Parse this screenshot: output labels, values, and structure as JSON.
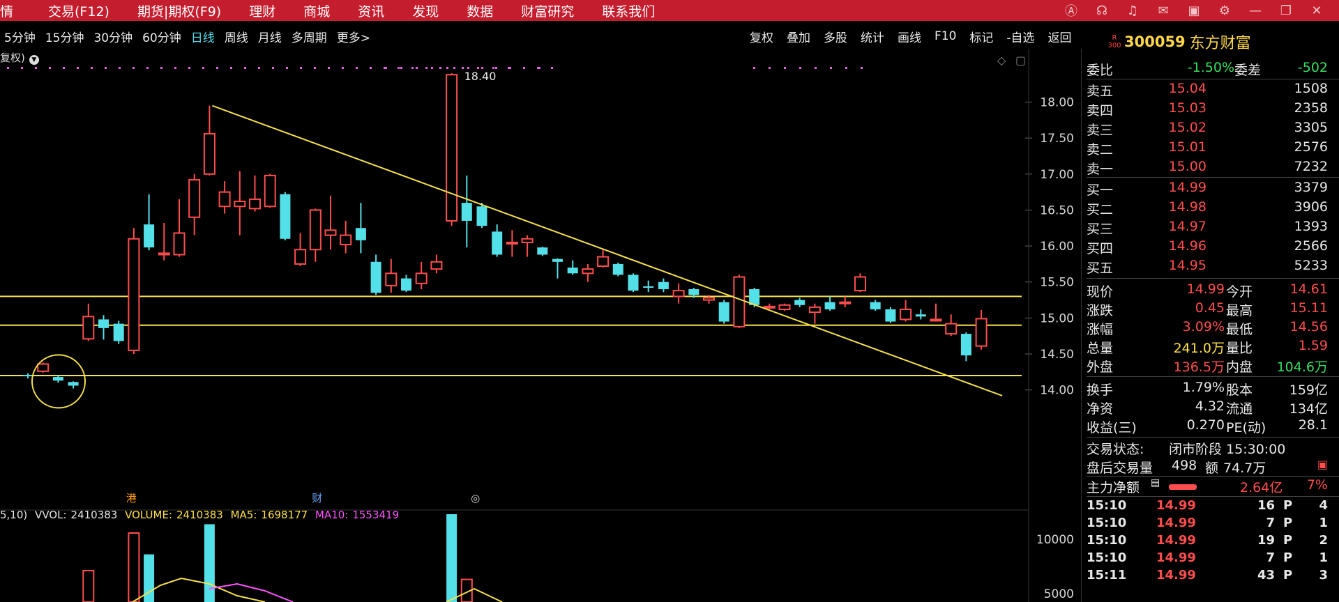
{
  "menu": [
    "情",
    "交易(F12)",
    "期货|期权(F9)",
    "理财",
    "商城",
    "资讯",
    "发现",
    "数据",
    "财富研究",
    "联系我们"
  ],
  "window_icons": [
    "ai-icon",
    "headset-icon",
    "alert-icon",
    "message-icon",
    "box-icon",
    "gear-icon",
    "minimize-icon",
    "restore-icon",
    "close-icon"
  ],
  "periods": [
    {
      "label": "5分钟",
      "active": false
    },
    {
      "label": "15分钟",
      "active": false
    },
    {
      "label": "30分钟",
      "active": false
    },
    {
      "label": "60分钟",
      "active": false
    },
    {
      "label": "日线",
      "active": true
    },
    {
      "label": "周线",
      "active": false
    },
    {
      "label": "月线",
      "active": false
    },
    {
      "label": "多周期",
      "active": false
    },
    {
      "label": "更多>",
      "active": false
    }
  ],
  "tools": [
    "复权",
    "叠加",
    "多股",
    "统计",
    "画线",
    "F10",
    "标记",
    "-自选",
    "返回"
  ],
  "stock": {
    "badge_top": "R",
    "badge_bottom": "300",
    "code": "300059",
    "name": "东方财富"
  },
  "fq_label": "复权)",
  "chart_data": {
    "type": "candlestick",
    "y_ticks": [
      "18.00",
      "17.50",
      "17.00",
      "16.50",
      "16.00",
      "15.50",
      "15.00",
      "14.50",
      "14.00"
    ],
    "ylim": [
      13.9,
      18.45
    ],
    "high_label": "18.40",
    "candles": [
      {
        "o": 14.21,
        "c": 14.19,
        "h": 14.23,
        "l": 14.16
      },
      {
        "o": 14.26,
        "c": 14.36,
        "h": 14.38,
        "l": 14.24
      },
      {
        "o": 14.18,
        "c": 14.13,
        "h": 14.2,
        "l": 14.1
      },
      {
        "o": 14.11,
        "c": 14.06,
        "h": 14.12,
        "l": 14.02
      },
      {
        "o": 14.71,
        "c": 15.02,
        "h": 15.2,
        "l": 14.68
      },
      {
        "o": 14.98,
        "c": 14.86,
        "h": 15.04,
        "l": 14.7
      },
      {
        "o": 14.92,
        "c": 14.68,
        "h": 14.96,
        "l": 14.64
      },
      {
        "o": 14.55,
        "c": 16.1,
        "h": 16.25,
        "l": 14.5
      },
      {
        "o": 16.3,
        "c": 15.98,
        "h": 16.72,
        "l": 15.94
      },
      {
        "o": 15.88,
        "c": 15.9,
        "h": 16.32,
        "l": 15.8
      },
      {
        "o": 15.88,
        "c": 16.18,
        "h": 16.65,
        "l": 15.85
      },
      {
        "o": 16.4,
        "c": 16.92,
        "h": 17.0,
        "l": 16.15
      },
      {
        "o": 17.0,
        "c": 17.56,
        "h": 17.95,
        "l": 16.98
      },
      {
        "o": 16.55,
        "c": 16.75,
        "h": 16.9,
        "l": 16.45
      },
      {
        "o": 16.55,
        "c": 16.62,
        "h": 17.04,
        "l": 16.15
      },
      {
        "o": 16.52,
        "c": 16.65,
        "h": 16.98,
        "l": 16.48
      },
      {
        "o": 16.55,
        "c": 16.98,
        "h": 17.0,
        "l": 16.53
      },
      {
        "o": 16.72,
        "c": 16.1,
        "h": 16.75,
        "l": 16.08
      },
      {
        "o": 15.75,
        "c": 15.95,
        "h": 16.18,
        "l": 15.72
      },
      {
        "o": 15.95,
        "c": 16.5,
        "h": 16.52,
        "l": 15.78
      },
      {
        "o": 16.15,
        "c": 16.22,
        "h": 16.7,
        "l": 15.95
      },
      {
        "o": 16.02,
        "c": 16.15,
        "h": 16.35,
        "l": 15.9
      },
      {
        "o": 16.25,
        "c": 16.08,
        "h": 16.6,
        "l": 15.9
      },
      {
        "o": 15.78,
        "c": 15.35,
        "h": 15.88,
        "l": 15.32
      },
      {
        "o": 15.45,
        "c": 15.62,
        "h": 15.82,
        "l": 15.35
      },
      {
        "o": 15.55,
        "c": 15.38,
        "h": 15.6,
        "l": 15.36
      },
      {
        "o": 15.48,
        "c": 15.62,
        "h": 15.78,
        "l": 15.4
      },
      {
        "o": 15.68,
        "c": 15.78,
        "h": 15.88,
        "l": 15.62
      },
      {
        "o": 16.35,
        "c": 18.38,
        "h": 18.4,
        "l": 16.28
      },
      {
        "o": 16.6,
        "c": 16.35,
        "h": 16.98,
        "l": 15.98
      },
      {
        "o": 16.55,
        "c": 16.28,
        "h": 16.6,
        "l": 16.25
      },
      {
        "o": 16.2,
        "c": 15.88,
        "h": 16.3,
        "l": 15.85
      },
      {
        "o": 16.05,
        "c": 16.05,
        "h": 16.22,
        "l": 15.85
      },
      {
        "o": 16.05,
        "c": 16.1,
        "h": 16.15,
        "l": 15.85
      },
      {
        "o": 15.98,
        "c": 15.88,
        "h": 15.99,
        "l": 15.86
      },
      {
        "o": 15.82,
        "c": 15.78,
        "h": 15.83,
        "l": 15.55
      },
      {
        "o": 15.7,
        "c": 15.62,
        "h": 15.8,
        "l": 15.6
      },
      {
        "o": 15.62,
        "c": 15.68,
        "h": 15.75,
        "l": 15.5
      },
      {
        "o": 15.72,
        "c": 15.85,
        "h": 15.95,
        "l": 15.7
      },
      {
        "o": 15.75,
        "c": 15.6,
        "h": 15.77,
        "l": 15.58
      },
      {
        "o": 15.6,
        "c": 15.38,
        "h": 15.62,
        "l": 15.36
      },
      {
        "o": 15.44,
        "c": 15.42,
        "h": 15.52,
        "l": 15.36
      },
      {
        "o": 15.5,
        "c": 15.4,
        "h": 15.55,
        "l": 15.36
      },
      {
        "o": 15.3,
        "c": 15.38,
        "h": 15.48,
        "l": 15.2
      },
      {
        "o": 15.4,
        "c": 15.32,
        "h": 15.42,
        "l": 15.28
      },
      {
        "o": 15.25,
        "c": 15.28,
        "h": 15.32,
        "l": 15.2
      },
      {
        "o": 15.22,
        "c": 14.95,
        "h": 15.25,
        "l": 14.92
      },
      {
        "o": 14.88,
        "c": 15.57,
        "h": 15.6,
        "l": 14.86
      },
      {
        "o": 15.4,
        "c": 15.18,
        "h": 15.42,
        "l": 15.15
      },
      {
        "o": 15.15,
        "c": 15.16,
        "h": 15.2,
        "l": 15.12
      },
      {
        "o": 15.12,
        "c": 15.18,
        "h": 15.2,
        "l": 15.1
      },
      {
        "o": 15.25,
        "c": 15.18,
        "h": 15.28,
        "l": 15.15
      },
      {
        "o": 15.08,
        "c": 15.15,
        "h": 15.2,
        "l": 14.92
      },
      {
        "o": 15.22,
        "c": 15.12,
        "h": 15.3,
        "l": 15.1
      },
      {
        "o": 15.22,
        "c": 15.22,
        "h": 15.3,
        "l": 15.15
      },
      {
        "o": 15.38,
        "c": 15.57,
        "h": 15.62,
        "l": 15.36
      },
      {
        "o": 15.22,
        "c": 15.12,
        "h": 15.25,
        "l": 15.1
      },
      {
        "o": 15.12,
        "c": 14.95,
        "h": 15.15,
        "l": 14.93
      },
      {
        "o": 14.98,
        "c": 15.12,
        "h": 15.25,
        "l": 14.95
      },
      {
        "o": 15.05,
        "c": 15.02,
        "h": 15.12,
        "l": 14.98
      },
      {
        "o": 14.98,
        "c": 14.98,
        "h": 15.2,
        "l": 14.95
      },
      {
        "o": 14.78,
        "c": 14.92,
        "h": 15.05,
        "l": 14.75
      },
      {
        "o": 14.78,
        "c": 14.48,
        "h": 14.8,
        "l": 14.4
      },
      {
        "o": 14.61,
        "c": 14.99,
        "h": 15.11,
        "l": 14.56
      }
    ],
    "horizontal_lines": [
      15.3,
      14.9,
      14.2
    ],
    "trendline": {
      "from": [
        12,
        17.95
      ],
      "to": [
        63,
        13.92
      ]
    },
    "markers": [
      "港",
      "财",
      "◎"
    ],
    "volume": {
      "legend": {
        "prefix": "5,10)",
        "vvol_label": "VVOL:",
        "vvol": "2410383",
        "volume_label": "VOLUME:",
        "volume": "2410383",
        "ma5_label": "MA5:",
        "ma5": "1698177",
        "ma10_label": "MA10:",
        "ma10": "1553419"
      },
      "y_ticks": [
        "10000",
        "5000"
      ],
      "bars": [
        {
          "i": 4,
          "v": 0.25,
          "up": true
        },
        {
          "i": 7,
          "v": 0.55,
          "up": true
        },
        {
          "i": 8,
          "v": 0.38,
          "up": false
        },
        {
          "i": 12,
          "v": 0.62,
          "up": false
        },
        {
          "i": 28,
          "v": 0.7,
          "up": false
        },
        {
          "i": 29,
          "v": 0.18,
          "up": true
        }
      ]
    }
  },
  "quote": {
    "weibi_label": "委比",
    "weibi": "-1.50%",
    "weicha_label": "委差",
    "weicha": "-502",
    "asks": [
      {
        "label": "卖五",
        "price": "15.04",
        "vol": "1508"
      },
      {
        "label": "卖四",
        "price": "15.03",
        "vol": "2358"
      },
      {
        "label": "卖三",
        "price": "15.02",
        "vol": "3305"
      },
      {
        "label": "卖二",
        "price": "15.01",
        "vol": "2576"
      },
      {
        "label": "卖一",
        "price": "15.00",
        "vol": "7232"
      }
    ],
    "bids": [
      {
        "label": "买一",
        "price": "14.99",
        "vol": "3379"
      },
      {
        "label": "买二",
        "price": "14.98",
        "vol": "3906"
      },
      {
        "label": "买三",
        "price": "14.97",
        "vol": "1393"
      },
      {
        "label": "买四",
        "price": "14.96",
        "vol": "2566"
      },
      {
        "label": "买五",
        "price": "14.95",
        "vol": "5233"
      }
    ],
    "stats": [
      {
        "l1": "现价",
        "v1": "14.99",
        "c1": "red",
        "l2": "今开",
        "v2": "14.61",
        "c2": "red"
      },
      {
        "l1": "涨跌",
        "v1": "0.45",
        "c1": "red",
        "l2": "最高",
        "v2": "15.11",
        "c2": "red"
      },
      {
        "l1": "涨幅",
        "v1": "3.09%",
        "c1": "red",
        "l2": "最低",
        "v2": "14.56",
        "c2": "red"
      },
      {
        "l1": "总量",
        "v1": "241.0万",
        "c1": "yellow",
        "l2": "量比",
        "v2": "1.59",
        "c2": "red"
      },
      {
        "l1": "外盘",
        "v1": "136.5万",
        "c1": "red",
        "l2": "内盘",
        "v2": "104.6万",
        "c2": "green"
      }
    ],
    "fund": [
      {
        "l1": "换手",
        "v1": "1.79%",
        "l2": "股本",
        "v2": "159亿"
      },
      {
        "l1": "净资",
        "v1": "4.32",
        "l2": "流通",
        "v2": "134亿"
      },
      {
        "l1": "收益(三)",
        "v1": "0.270",
        "l2": "PE(动)",
        "v2": "28.1"
      }
    ],
    "status_label": "交易状态:",
    "status_value": "闭市阶段 15:30:00",
    "after_label": "盘后交易量",
    "after_vol": "498",
    "after_amt_label": "额",
    "after_amt": "74.7万",
    "flow_label": "主力净额",
    "flow_value": "2.64亿",
    "flow_pct": "7%"
  },
  "trades": [
    {
      "time": "15:10",
      "price": "14.99",
      "qty": "16",
      "flag": "P",
      "n": "4"
    },
    {
      "time": "15:10",
      "price": "14.99",
      "qty": "7",
      "flag": "P",
      "n": "1"
    },
    {
      "time": "15:10",
      "price": "14.99",
      "qty": "19",
      "flag": "P",
      "n": "2"
    },
    {
      "time": "15:10",
      "price": "14.99",
      "qty": "7",
      "flag": "P",
      "n": "1"
    },
    {
      "time": "15:11",
      "price": "14.99",
      "qty": "43",
      "flag": "P",
      "n": "3"
    }
  ]
}
